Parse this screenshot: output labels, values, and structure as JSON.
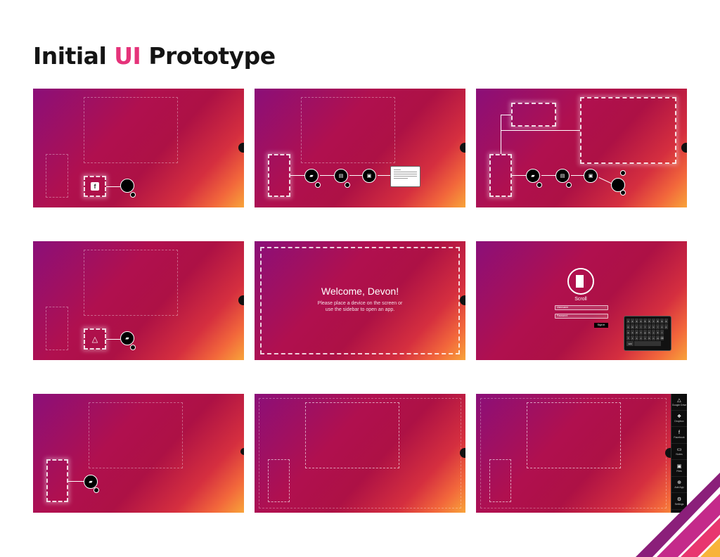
{
  "page": {
    "title_part1": "Initial ",
    "title_accent": "UI",
    "title_part2": " Prototype",
    "accent_color": "#e5337a"
  },
  "panels": {
    "welcome": {
      "heading": "Welcome, Devon!",
      "line1": "Please place a device on the screen or",
      "line2": "use the sidebar to open an app."
    },
    "login": {
      "app_label": "Scroll",
      "username_placeholder": "Username",
      "password_placeholder": "Password",
      "signin_label": "Sign in",
      "keyboard_rows": [
        [
          "1",
          "2",
          "3",
          "4",
          "5",
          "6",
          "7",
          "8",
          "9",
          "0"
        ],
        [
          "q",
          "w",
          "e",
          "r",
          "t",
          "y",
          "u",
          "i",
          "o",
          "p"
        ],
        [
          "a",
          "s",
          "d",
          "f",
          "g",
          "h",
          "j",
          "k",
          "l"
        ],
        [
          "⇧",
          "z",
          "x",
          "c",
          "v",
          "b",
          "n",
          "m",
          "⌫"
        ]
      ],
      "keyboard_mode": "123"
    },
    "sidebar": {
      "items": [
        {
          "icon": "google-drive-icon",
          "label": "Google Drive"
        },
        {
          "icon": "dropbox-icon",
          "label": "Dropbox"
        },
        {
          "icon": "facebook-icon",
          "label": "Facebook"
        },
        {
          "icon": "notes-icon",
          "label": "Notes"
        },
        {
          "icon": "briefcase-icon",
          "label": "Files"
        },
        {
          "icon": "plus-icon",
          "label": "Add App"
        },
        {
          "icon": "gear-icon",
          "label": "Settings"
        }
      ]
    }
  }
}
